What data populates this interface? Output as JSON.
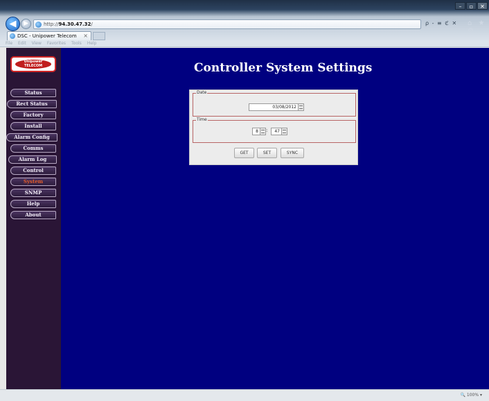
{
  "browser": {
    "url_prefix": "http://",
    "url_host": "94.30.47.32",
    "url_suffix": "/",
    "address_tools": "ρ - ≡ ℭ ✕",
    "tab": {
      "title": "DSC - Unipower Telecom",
      "close": "×"
    },
    "window_buttons": {
      "minimize": "–",
      "maximize": "▫",
      "close": "✕"
    },
    "nav_icons": "⌂ ★ ⚙",
    "menu": [
      "File",
      "Edit",
      "View",
      "Favorites",
      "Tools",
      "Help"
    ],
    "status": {
      "zoom": "🔍 100%  ▾"
    }
  },
  "page": {
    "logo": {
      "line1": "Unipower",
      "line2": "TELECOM"
    },
    "title": "Controller System Settings",
    "sidebar": {
      "items": [
        {
          "label": "Status",
          "active": false
        },
        {
          "label": "Rect Status",
          "active": false
        },
        {
          "label": "Factory",
          "active": false
        },
        {
          "label": "Install",
          "active": false
        },
        {
          "label": "Alarm Config",
          "active": false
        },
        {
          "label": "Comms",
          "active": false
        },
        {
          "label": "Alarm Log",
          "active": false
        },
        {
          "label": "Control",
          "active": false
        },
        {
          "label": "System",
          "active": true
        },
        {
          "label": "SNMP",
          "active": false
        },
        {
          "label": "Help",
          "active": false
        },
        {
          "label": "About",
          "active": false
        }
      ],
      "active_color": "#e05a2a"
    },
    "settings": {
      "date_label": "Date",
      "date_value": "03/08/2012",
      "time_label": "Time",
      "hour": "8",
      "separator": ":",
      "minute": "47",
      "buttons": {
        "get": "GET",
        "set": "SET",
        "sync": "SYNC"
      }
    },
    "colors": {
      "background": "#000080",
      "sidebar": "#2a1536",
      "group_border": "#b86565"
    }
  }
}
